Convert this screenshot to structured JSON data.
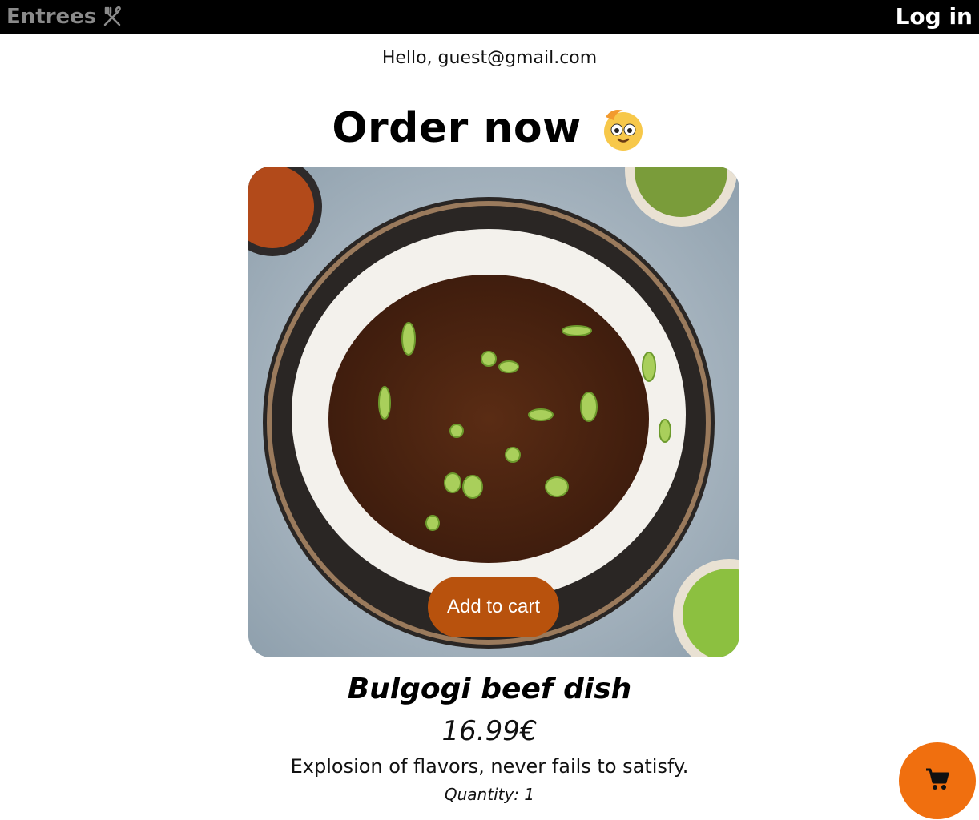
{
  "header": {
    "brand_label": "Entrees",
    "login_label": "Log in"
  },
  "greeting": "Hello, guest@gmail.com",
  "page_title": "Order now",
  "product": {
    "add_to_cart_label": "Add to cart",
    "name": "Bulgogi beef dish",
    "price": "16.99€",
    "description": "Explosion of flavors, never fails to satisfy.",
    "quantity": "Quantity: 1"
  },
  "icons": {
    "brand_icon": "utensils-icon",
    "title_emoji": "face-emoji-icon",
    "cart_icon": "cart-icon"
  },
  "colors": {
    "topbar": "#000000",
    "brand_text": "#8a8a8a",
    "add_button": "#b8520d",
    "cart_fab": "#f06f0f"
  }
}
